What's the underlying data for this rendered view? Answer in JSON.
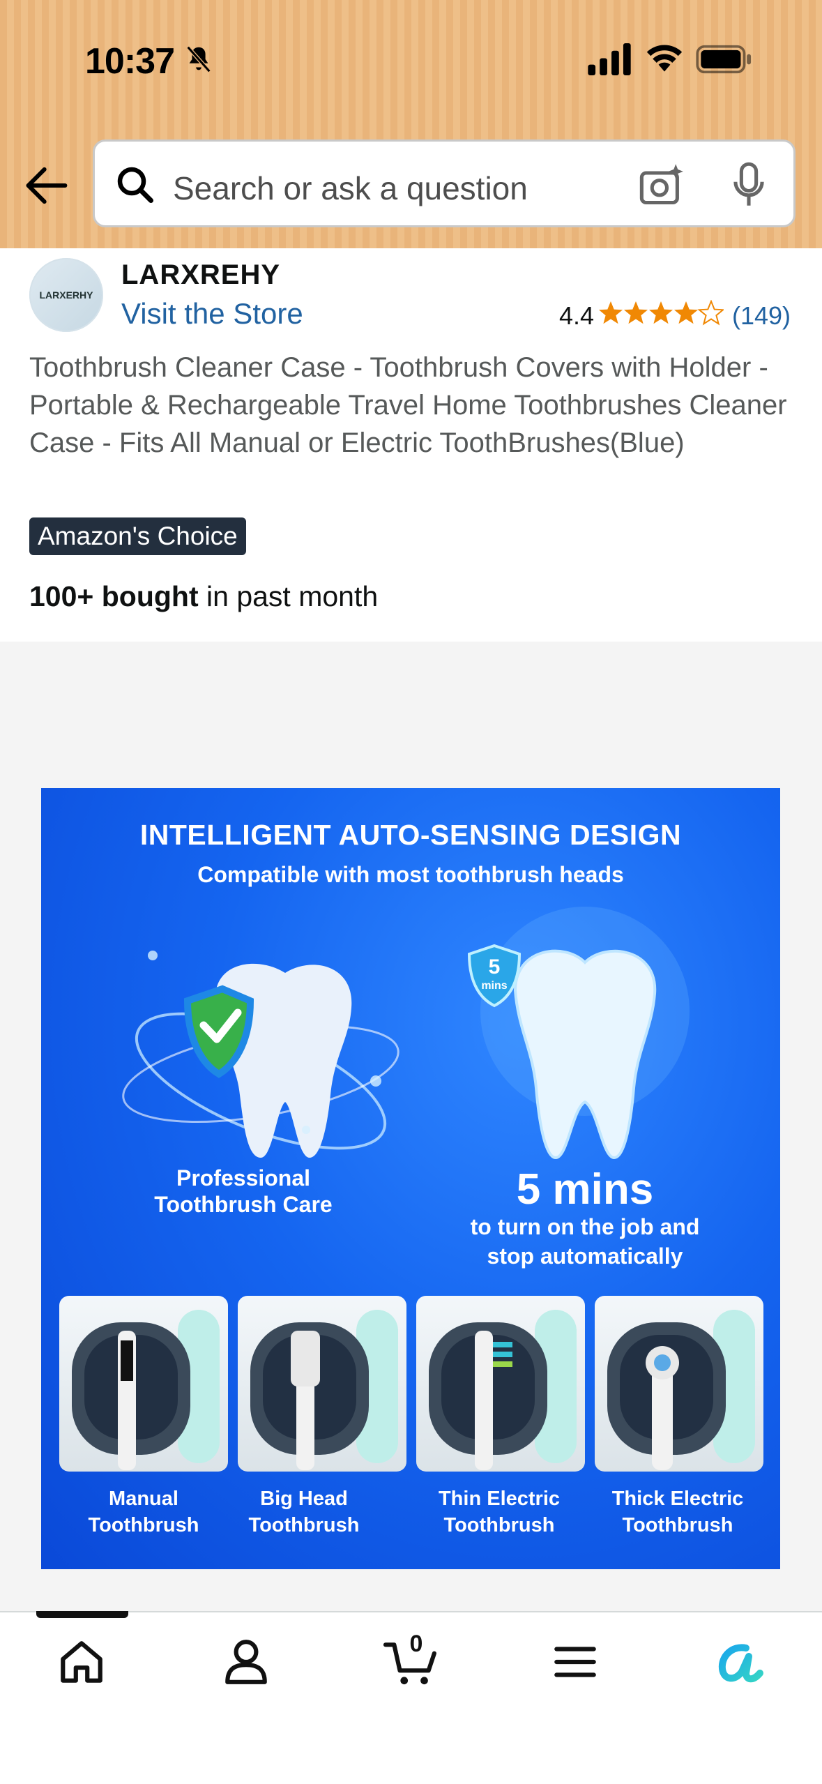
{
  "status_bar": {
    "time": "10:37"
  },
  "search": {
    "placeholder": "Search or ask a question"
  },
  "store": {
    "logo_text": "LARXERHY",
    "name": "LARXREHY",
    "visit_label": "Visit the Store"
  },
  "rating": {
    "value": "4.4",
    "stars": 4.4,
    "count": "(149)"
  },
  "product": {
    "title": "Toothbrush Cleaner Case - Toothbrush Covers with Holder - Portable & Rechargeable Travel Home Toothbrushes Cleaner Case - Fits All Manual or Electric ToothBrushes(Blue)",
    "badge": "Amazon's Choice",
    "bought_bold": "100+ bought",
    "bought_rest": " in past month"
  },
  "image": {
    "heading": "INTELLIGENT AUTO-SENSING DESIGN",
    "subheading": "Compatible with most toothbrush heads",
    "shield_badge_num": "5",
    "shield_badge_unit": "mins",
    "care_line1": "Professional",
    "care_line2": "Toothbrush Care",
    "mins_big": "5 mins",
    "turn_line1": "to turn on the job and",
    "turn_line2": "stop automatically",
    "tiles": [
      {
        "line1": "Manual",
        "line2": "Toothbrush"
      },
      {
        "line1": "Big Head",
        "line2": "Toothbrush"
      },
      {
        "line1": "Thin Electric",
        "line2": "Toothbrush"
      },
      {
        "line1": "Thick Electric",
        "line2": "Toothbrush"
      }
    ]
  },
  "bottom_nav": {
    "cart_count": "0"
  },
  "colors": {
    "header": "#e9b47a",
    "link": "#2162a1",
    "star": "#f08804",
    "badge": "#232f3e",
    "image_blue": "#1565f0"
  }
}
